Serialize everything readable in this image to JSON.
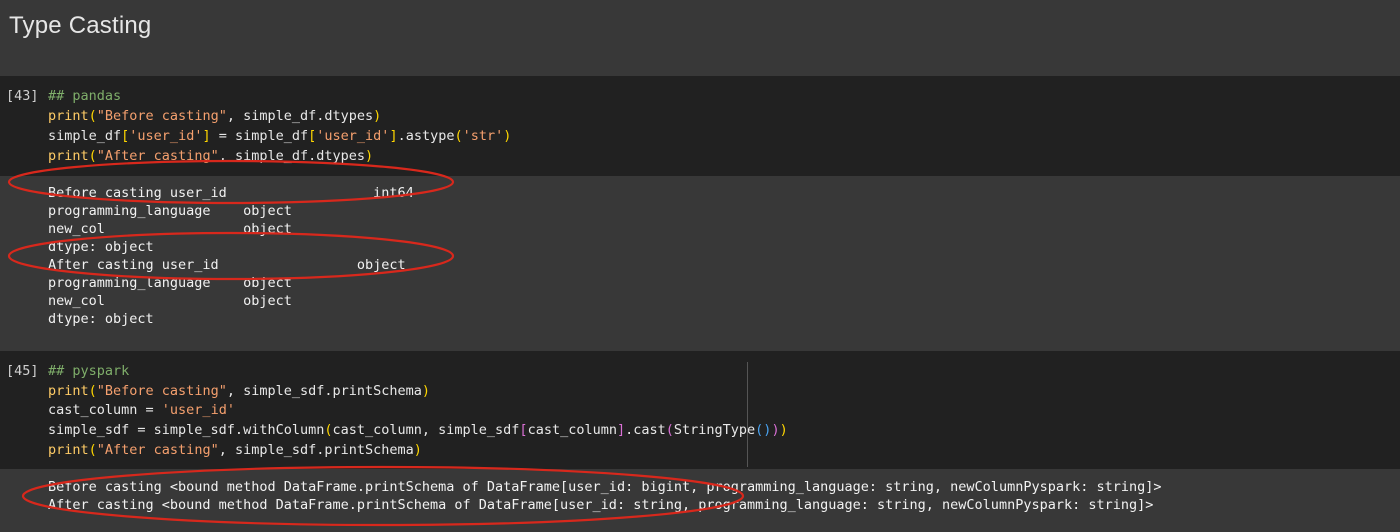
{
  "section": {
    "title": "Type Casting"
  },
  "cells": [
    {
      "prompt": "[43]",
      "code": [
        [
          {
            "t": "## pandas",
            "c": "c-cmt"
          }
        ],
        [
          {
            "t": "print",
            "c": "c-fn"
          },
          {
            "t": "(",
            "c": "c-br1"
          },
          {
            "t": "\"Before casting\"",
            "c": "c-str"
          },
          {
            "t": ", simple_df.dtypes",
            "c": "c-txt"
          },
          {
            "t": ")",
            "c": "c-br1"
          }
        ],
        [
          {
            "t": "simple_df",
            "c": "c-txt"
          },
          {
            "t": "[",
            "c": "c-br1"
          },
          {
            "t": "'user_id'",
            "c": "c-str"
          },
          {
            "t": "]",
            "c": "c-br1"
          },
          {
            "t": " = simple_df",
            "c": "c-txt"
          },
          {
            "t": "[",
            "c": "c-br1"
          },
          {
            "t": "'user_id'",
            "c": "c-str"
          },
          {
            "t": "]",
            "c": "c-br1"
          },
          {
            "t": ".astype",
            "c": "c-txt"
          },
          {
            "t": "(",
            "c": "c-br1"
          },
          {
            "t": "'str'",
            "c": "c-str"
          },
          {
            "t": ")",
            "c": "c-br1"
          }
        ],
        [
          {
            "t": "print",
            "c": "c-fn"
          },
          {
            "t": "(",
            "c": "c-br1"
          },
          {
            "t": "\"After casting\"",
            "c": "c-str"
          },
          {
            "t": ", simple_df.dtypes",
            "c": "c-txt"
          },
          {
            "t": ")",
            "c": "c-br1"
          }
        ]
      ],
      "output": [
        "Before casting user_id                  int64",
        "programming_language    object",
        "new_col                 object",
        "dtype: object",
        "After casting user_id                 object",
        "programming_language    object",
        "new_col                 object",
        "dtype: object"
      ]
    },
    {
      "prompt": "[45]",
      "code": [
        [
          {
            "t": "## pyspark",
            "c": "c-cmt"
          }
        ],
        [
          {
            "t": "print",
            "c": "c-fn"
          },
          {
            "t": "(",
            "c": "c-br1"
          },
          {
            "t": "\"Before casting\"",
            "c": "c-str"
          },
          {
            "t": ", simple_sdf.printSchema",
            "c": "c-txt"
          },
          {
            "t": ")",
            "c": "c-br1"
          }
        ],
        [
          {
            "t": "cast_column = ",
            "c": "c-txt"
          },
          {
            "t": "'user_id'",
            "c": "c-str"
          }
        ],
        [
          {
            "t": "simple_sdf = simple_sdf.withColumn",
            "c": "c-txt"
          },
          {
            "t": "(",
            "c": "c-br1"
          },
          {
            "t": "cast_column, simple_sdf",
            "c": "c-txt"
          },
          {
            "t": "[",
            "c": "c-br2"
          },
          {
            "t": "cast_column",
            "c": "c-txt"
          },
          {
            "t": "]",
            "c": "c-br2"
          },
          {
            "t": ".cast",
            "c": "c-txt"
          },
          {
            "t": "(",
            "c": "c-br2"
          },
          {
            "t": "StringType",
            "c": "c-txt"
          },
          {
            "t": "()",
            "c": "c-br3"
          },
          {
            "t": ")",
            "c": "c-br2"
          },
          {
            "t": ")",
            "c": "c-br1"
          }
        ],
        [
          {
            "t": "print",
            "c": "c-fn"
          },
          {
            "t": "(",
            "c": "c-br1"
          },
          {
            "t": "\"After casting\"",
            "c": "c-str"
          },
          {
            "t": ", simple_sdf.printSchema",
            "c": "c-txt"
          },
          {
            "t": ")",
            "c": "c-br1"
          }
        ]
      ],
      "output": [
        "Before casting <bound method DataFrame.printSchema of DataFrame[user_id: bigint, programming_language: string, newColumnPyspark: string]>",
        "After casting <bound method DataFrame.printSchema of DataFrame[user_id: string, programming_language: string, newColumnPyspark: string]>"
      ]
    }
  ],
  "annotation_color": "#d8281c"
}
